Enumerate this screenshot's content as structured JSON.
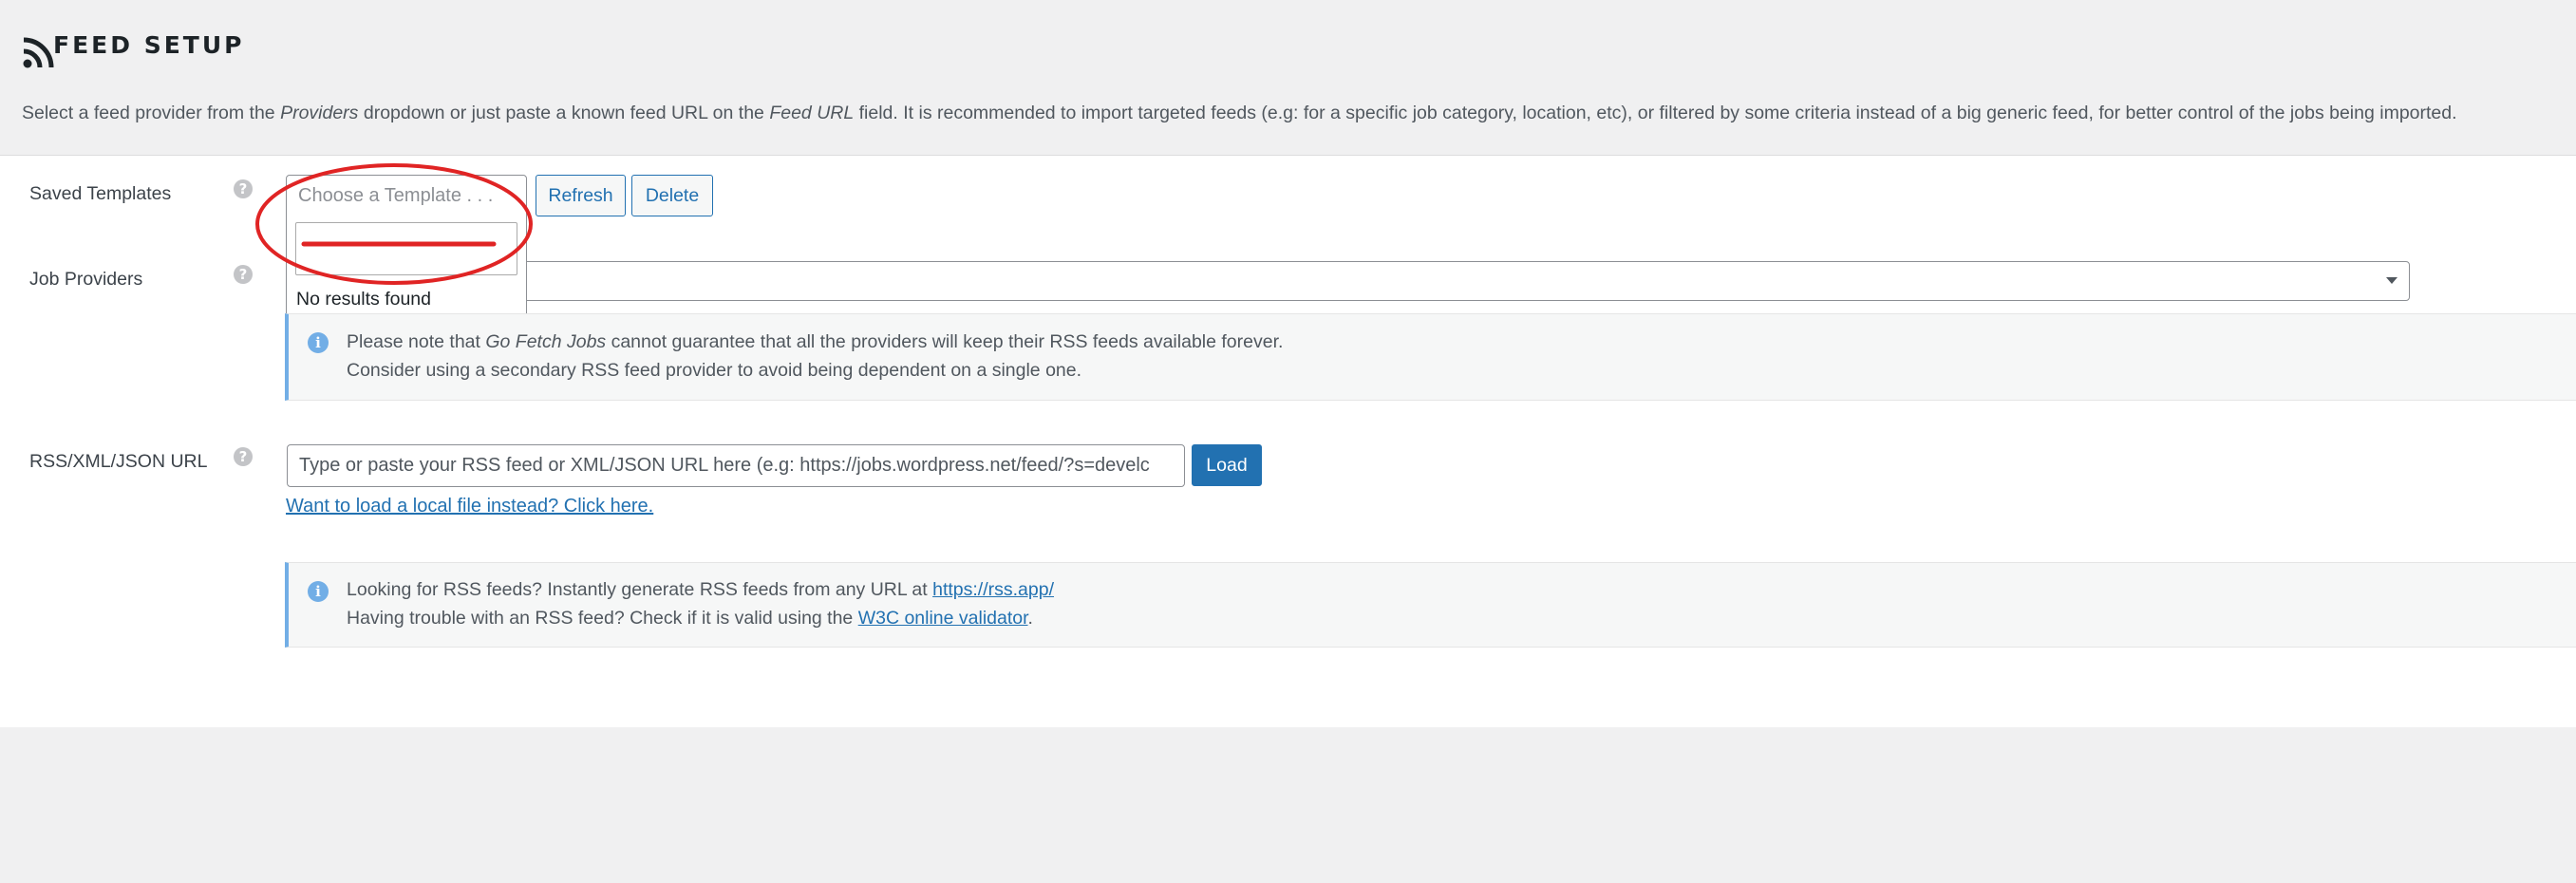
{
  "header": {
    "title": "FEED SETUP",
    "icon": "rss-icon"
  },
  "intro": {
    "part1": "Select a feed provider from the ",
    "providers": "Providers",
    "part2": " dropdown or just paste a known feed URL on the ",
    "feed_url": "Feed URL",
    "part3": " field. It is recommended to import targeted feeds (e.g: for a specific job category, location, etc), or filtered by some criteria instead of a big generic feed, for better control of the jobs being imported."
  },
  "saved_templates": {
    "label": "Saved Templates",
    "help": "?",
    "placeholder": "Choose a Template . . .",
    "refresh_label": "Refresh",
    "delete_label": "Delete",
    "dropdown": {
      "search_value": "",
      "no_results": "No results found"
    }
  },
  "job_providers": {
    "label": "Job Providers",
    "help": "?",
    "notice": {
      "icon": "i",
      "line1_part1": "Please note that ",
      "line1_em": "Go Fetch Jobs",
      "line1_part2": " cannot guarantee that all the providers will keep their RSS feeds available forever.",
      "line2": "Consider using a secondary RSS feed provider to avoid being dependent on a single one."
    }
  },
  "rss_url": {
    "label": "RSS/XML/JSON URL",
    "help": "?",
    "placeholder": "Type or paste your RSS feed or XML/JSON URL here (e.g: https://jobs.wordpress.net/feed/?s=develc",
    "load_label": "Load",
    "local_link": "Want to load a local file instead? Click here.",
    "notice": {
      "icon": "i",
      "line1_text": "Looking for RSS feeds? Instantly generate RSS feeds from any URL at ",
      "line1_link": "https://rss.app/",
      "line2_text": "Having trouble with an RSS feed? Check if it is valid using the ",
      "line2_link": "W3C online validator",
      "line2_end": "."
    }
  },
  "colors": {
    "accent": "#2271b1",
    "info": "#72aee6",
    "annotation": "#e02424"
  }
}
